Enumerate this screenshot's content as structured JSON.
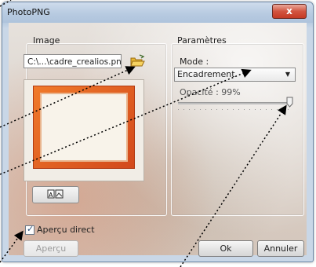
{
  "window": {
    "title": "PhotoPNG",
    "close_glyph": "x"
  },
  "image_group": {
    "label": "Image",
    "path_value": "C:\\...\\cadre_crealios.png",
    "folder_icon": "folder-open-icon",
    "preview_icon": "image-arrange-icon"
  },
  "params_group": {
    "label": "Paramètres",
    "mode_label": "Mode :",
    "mode_value": "Encadrement",
    "opacity_label": "Opacité : 99%",
    "opacity_value": 0.99
  },
  "footer": {
    "live_preview_label": "Aperçu direct",
    "live_preview_checked": true,
    "preview_button": "Aperçu",
    "ok_button": "Ok",
    "cancel_button": "Annuler"
  }
}
